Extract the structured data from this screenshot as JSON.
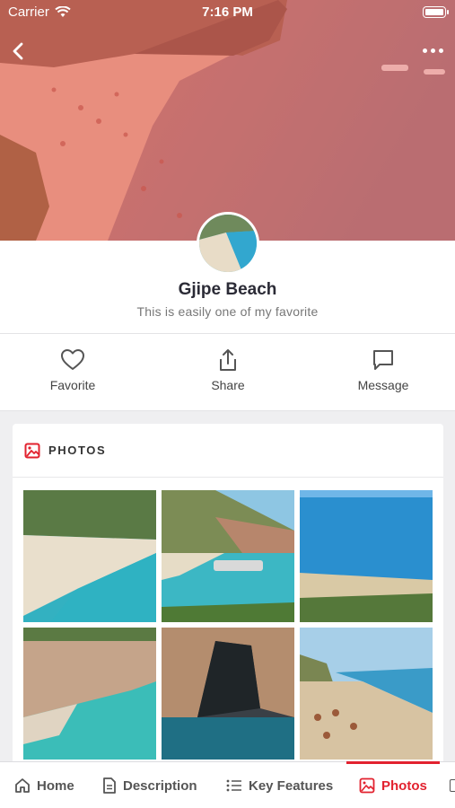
{
  "status_bar": {
    "carrier": "Carrier",
    "time": "7:16 PM"
  },
  "place": {
    "name": "Gjipe Beach",
    "description": "This is easily one of my favorite"
  },
  "actions": [
    {
      "label": "Favorite",
      "icon": "heart-icon"
    },
    {
      "label": "Share",
      "icon": "share-icon"
    },
    {
      "label": "Message",
      "icon": "message-icon"
    }
  ],
  "photos_section": {
    "title": "PHOTOS",
    "icon": "image-icon",
    "count": 6
  },
  "tabs": [
    {
      "label": "Home",
      "icon": "home-icon",
      "active": false
    },
    {
      "label": "Description",
      "icon": "document-icon",
      "active": false
    },
    {
      "label": "Key Features",
      "icon": "list-icon",
      "active": false
    },
    {
      "label": "Photos",
      "icon": "image-icon",
      "active": true
    }
  ],
  "colors": {
    "accent": "#e2222f",
    "hero_overlay": "#e8524f",
    "text_dark": "#2b2b36"
  }
}
